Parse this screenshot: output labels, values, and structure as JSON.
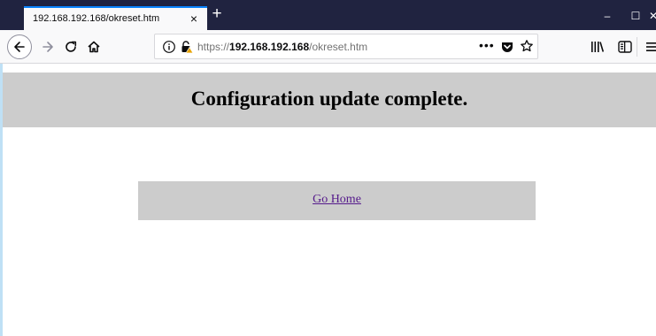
{
  "browser": {
    "tab": {
      "title": "192.168.192.168/okreset.htm",
      "close_glyph": "×"
    },
    "new_tab_glyph": "+",
    "window_controls": {
      "minimize": "–",
      "maximize": "☐",
      "close": "✕"
    },
    "nav": {
      "back_icon": "back-arrow-icon",
      "forward_icon": "forward-arrow-icon",
      "reload_icon": "reload-icon",
      "home_icon": "home-icon"
    },
    "urlbar": {
      "scheme": "https://",
      "host": "192.168.192.168",
      "path": "/okreset.htm",
      "more": "•••",
      "insecure_lock_color": "#e8a400"
    },
    "accent": "#0a84ff",
    "tabstrip_color": "#202340"
  },
  "page": {
    "heading": "Configuration update complete.",
    "home_link": "Go Home",
    "banner_color": "#cccccc",
    "link_color": "#551a8b"
  }
}
